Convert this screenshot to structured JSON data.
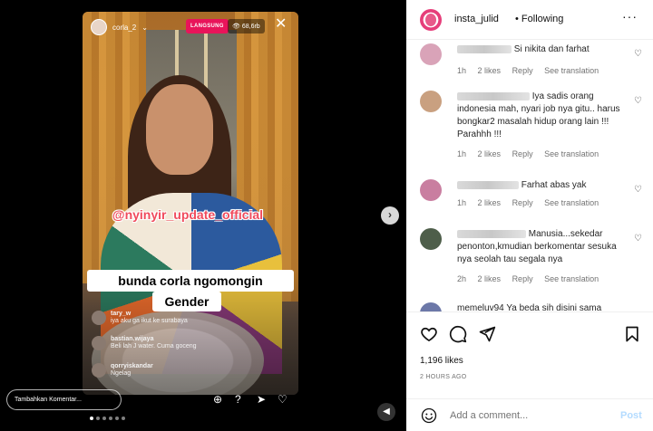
{
  "video": {
    "username": "corla_2",
    "live_badge": "LANGSUNG",
    "viewer_count": "68,6rb",
    "watermark": "@nyinyir_update_official",
    "caption_line1": "bunda corla ngomongin",
    "caption_line2": "Gender",
    "live_comments": [
      {
        "name": "tary_w",
        "text": "iya aku ga ikut ke surabaya"
      },
      {
        "name": "bastian.wijaya",
        "text": "Beli lah J water. Cuma goceng"
      },
      {
        "name": "qorryiskandar",
        "text": "Ngelag"
      }
    ],
    "input_placeholder": "Tambahkan Komentar..."
  },
  "post": {
    "username": "insta_julid",
    "follow_status": "Following",
    "likes": "1,196 likes",
    "time": "2 HOURS AGO",
    "add_comment_placeholder": "Add a comment...",
    "post_label": "Post"
  },
  "comments": [
    {
      "text": "Si nikita dan farhat",
      "age": "1h",
      "likes": "2 likes",
      "reply": "Reply",
      "translate": "See translation"
    },
    {
      "text": "Iya sadis orang indonesia mah, nyari job nya gitu.. harus bongkar2 masalah hidup orang lain !!! Parahhh !!!",
      "age": "1h",
      "likes": "2 likes",
      "reply": "Reply",
      "translate": "See translation"
    },
    {
      "text": "Farhat abas yak",
      "age": "1h",
      "likes": "2 likes",
      "reply": "Reply",
      "translate": "See translation"
    },
    {
      "text": "Manusia...sekedar penonton,kmudian berkomentar sesuka nya seolah tau segala nya",
      "age": "2h",
      "likes": "2 likes",
      "reply": "Reply",
      "translate": "See translation"
    },
    {
      "user": "memeluv94",
      "text": "Ya beda sih disini sama"
    }
  ]
}
